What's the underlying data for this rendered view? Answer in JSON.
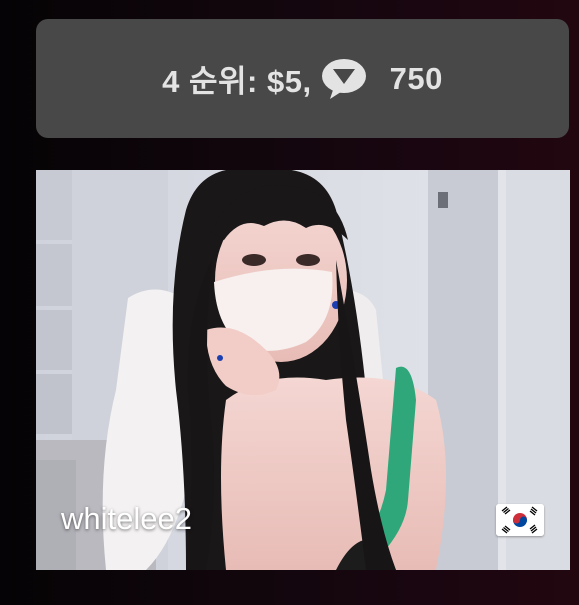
{
  "rank_card": {
    "rank_text": "4 순위: $5,",
    "tip_count": "750",
    "icon": "chat-bubble-icon"
  },
  "stream": {
    "username": "whitelee2",
    "country_flag": "south-korea-flag-icon",
    "thumbnail": "webcam-preview-image"
  },
  "colors": {
    "card_bg": "#484848",
    "card_text": "#e3e3e3",
    "page_bg": "#12060d"
  }
}
